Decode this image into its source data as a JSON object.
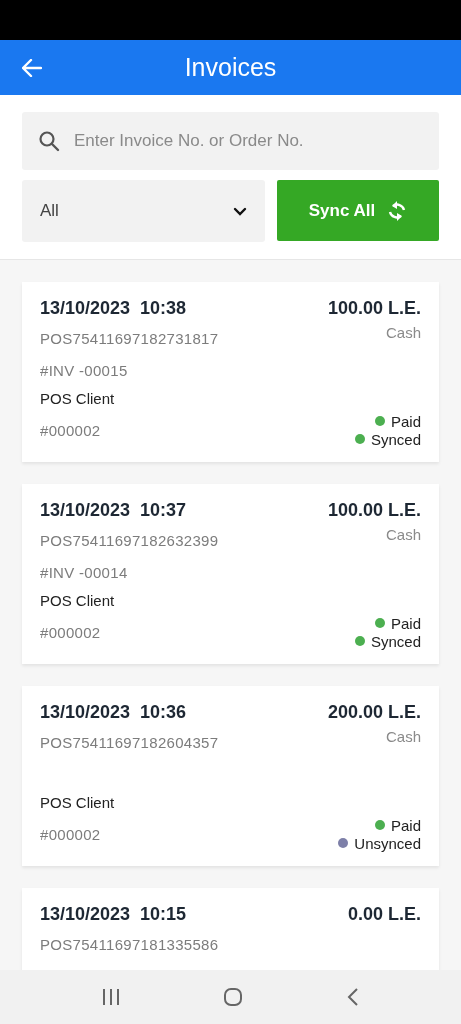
{
  "header": {
    "title": "Invoices"
  },
  "search": {
    "placeholder": "Enter Invoice No. or Order No."
  },
  "filter": {
    "value": "All"
  },
  "sync_button": {
    "label": "Sync All"
  },
  "invoices": [
    {
      "datetime": "13/10/2023  10:38",
      "order_no": "POS75411697182731817",
      "invoice_no": "#INV -00015",
      "client": "POS Client",
      "client_code": "#000002",
      "amount": "100.00 L.E.",
      "payment_method": "Cash",
      "statuses": [
        {
          "label": "Paid",
          "color": "#4caf50"
        },
        {
          "label": "Synced",
          "color": "#4caf50"
        }
      ]
    },
    {
      "datetime": "13/10/2023  10:37",
      "order_no": "POS75411697182632399",
      "invoice_no": "#INV -00014",
      "client": "POS Client",
      "client_code": "#000002",
      "amount": "100.00 L.E.",
      "payment_method": "Cash",
      "statuses": [
        {
          "label": "Paid",
          "color": "#4caf50"
        },
        {
          "label": "Synced",
          "color": "#4caf50"
        }
      ]
    },
    {
      "datetime": "13/10/2023  10:36",
      "order_no": "POS75411697182604357",
      "client": "POS Client",
      "client_code": "#000002",
      "amount": "200.00 L.E.",
      "payment_method": "Cash",
      "statuses": [
        {
          "label": "Paid",
          "color": "#4caf50"
        },
        {
          "label": "Unsynced",
          "color": "#7d7fa8"
        }
      ]
    },
    {
      "datetime": "13/10/2023  10:15",
      "order_no": "POS75411697181335586",
      "amount": "0.00 L.E."
    }
  ]
}
